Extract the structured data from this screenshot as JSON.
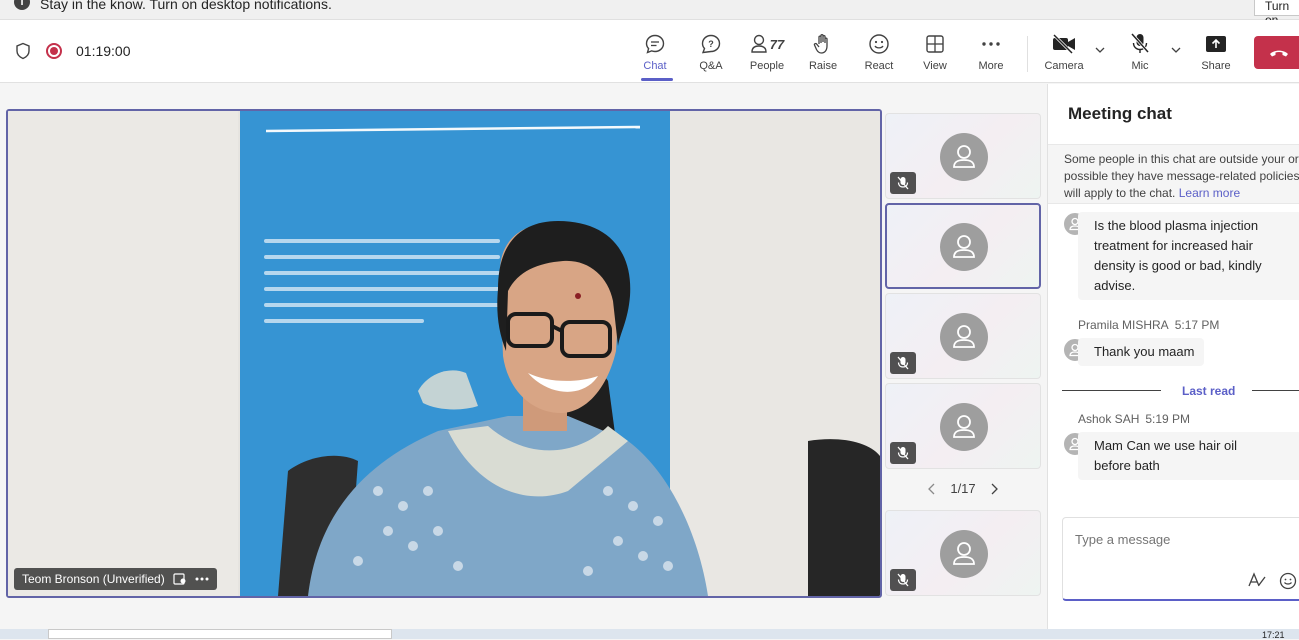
{
  "notification": {
    "message": "Stay in the know. Turn on desktop notifications.",
    "button_label": "Turn on"
  },
  "toolbar": {
    "timer": "01:19:00",
    "buttons": [
      {
        "label": "Chat",
        "icon": "chat-icon"
      },
      {
        "label": "Q&A",
        "icon": "qa-icon"
      },
      {
        "label": "People",
        "icon": "people-icon",
        "count": "77"
      },
      {
        "label": "Raise",
        "icon": "hand-icon"
      },
      {
        "label": "React",
        "icon": "emoji-icon"
      },
      {
        "label": "View",
        "icon": "grid-icon"
      },
      {
        "label": "More",
        "icon": "more-icon"
      },
      {
        "label": "Camera",
        "icon": "camera-off-icon"
      },
      {
        "label": "Mic",
        "icon": "mic-off-icon"
      },
      {
        "label": "Share",
        "icon": "share-icon"
      }
    ]
  },
  "stage": {
    "main_participant": "Teom Bronson (Unverified)",
    "pager": "1/17"
  },
  "chat": {
    "title": "Meeting chat",
    "notice_lines": [
      "Some people in this chat are outside your or",
      "possible they have message-related policies",
      "will apply to the chat."
    ],
    "notice_link": "Learn more",
    "messages": [
      {
        "sender": "",
        "time": "",
        "text_lines": [
          "Is the blood plasma injection",
          "treatment for increased hair",
          "density is good or bad, kindly",
          "advise."
        ]
      },
      {
        "sender": "Pramila MISHRA",
        "time": "5:17 PM",
        "text_lines": [
          "Thank you maam"
        ]
      },
      {
        "sender": "Ashok SAH",
        "time": "5:19 PM",
        "text_lines": [
          "Mam Can we use hair oil",
          "before bath"
        ]
      }
    ],
    "last_read_label": "Last read",
    "compose_placeholder": "Type a message"
  },
  "taskbar": {
    "clock": "17:21"
  },
  "colors": {
    "accent": "#5b5fc7",
    "leave_red": "#c4314b"
  }
}
